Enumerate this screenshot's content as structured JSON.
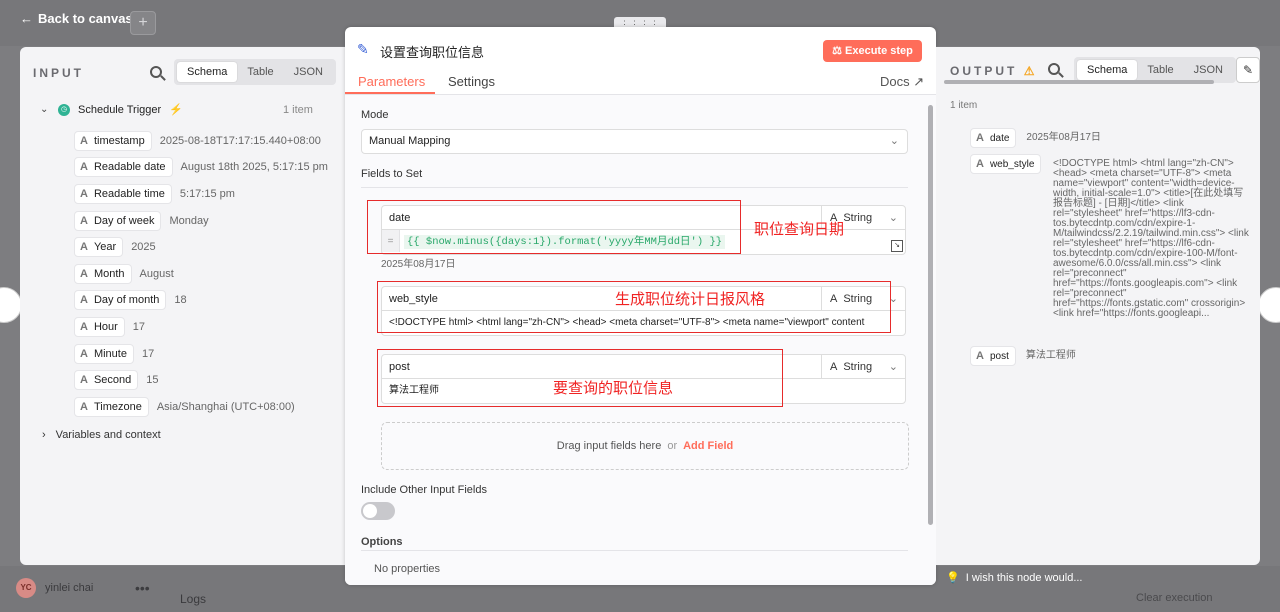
{
  "topbar": {
    "back_label": "Back to canvas",
    "plus": "+",
    "handle": "⋮⋮⋮⋮"
  },
  "input": {
    "title": "INPUT",
    "tabs": [
      "Schema",
      "Table",
      "JSON"
    ],
    "node": {
      "name": "Schedule Trigger",
      "count": "1 item"
    },
    "fields": [
      {
        "key": "timestamp",
        "value": "2025-08-18T17:17:15.440+08:00"
      },
      {
        "key": "Readable date",
        "value": "August 18th 2025, 5:17:15 pm"
      },
      {
        "key": "Readable time",
        "value": "5:17:15 pm"
      },
      {
        "key": "Day of week",
        "value": "Monday"
      },
      {
        "key": "Year",
        "value": "2025"
      },
      {
        "key": "Month",
        "value": "August"
      },
      {
        "key": "Day of month",
        "value": "18"
      },
      {
        "key": "Hour",
        "value": "17"
      },
      {
        "key": "Minute",
        "value": "17"
      },
      {
        "key": "Second",
        "value": "15"
      },
      {
        "key": "Timezone",
        "value": "Asia/Shanghai (UTC+08:00)"
      }
    ],
    "vars_label": "Variables and context"
  },
  "dialog": {
    "title": "设置查询职位信息",
    "execute": "Execute step",
    "tabs": {
      "parameters": "Parameters",
      "settings": "Settings",
      "docs": "Docs"
    },
    "mode_label": "Mode",
    "mode_value": "Manual Mapping",
    "fields_label": "Fields to Set",
    "type_label": "String",
    "fields": [
      {
        "name": "date",
        "value": "{{ $now.minus({days:1}).format('yyyy年MM月dd日') }}",
        "eq": "=",
        "preview": "2025年08月17日"
      },
      {
        "name": "web_style",
        "value": "<!DOCTYPE html> <html lang=\"zh-CN\"> <head>     <meta charset=\"UTF-8\">     <meta name=\"viewport\" content"
      },
      {
        "name": "post",
        "value": "算法工程师"
      }
    ],
    "annotations": [
      "职位查询日期",
      "生成职位统计日报风格",
      "要查询的职位信息"
    ],
    "drop_text": "Drag input fields here",
    "drop_or": "or",
    "drop_add": "Add Field",
    "include_label": "Include Other Input Fields",
    "options_label": "Options",
    "no_props": "No properties"
  },
  "output": {
    "title": "OUTPUT",
    "tabs": [
      "Schema",
      "Table",
      "JSON"
    ],
    "count": "1 item",
    "date_key": "date",
    "date_value": "2025年08月17日",
    "web_key": "web_style",
    "web_value": "<!DOCTYPE html> <html lang=\"zh-CN\"> <head> <meta charset=\"UTF-8\"> <meta name=\"viewport\" content=\"width=device-width, initial-scale=1.0\"> <title>[在此处填写报告标题] - [日期]</title> <link rel=\"stylesheet\" href=\"https://lf3-cdn-tos.bytecdntp.com/cdn/expire-1-M/tailwindcss/2.2.19/tailwind.min.css\"> <link rel=\"stylesheet\" href=\"https://lf6-cdn-tos.bytecdntp.com/cdn/expire-100-M/font-awesome/6.0.0/css/all.min.css\"> <link rel=\"preconnect\" href=\"https://fonts.googleapis.com\"> <link rel=\"preconnect\" href=\"https://fonts.gstatic.com\" crossorigin> <link href=\"https://fonts.googleapi...",
    "post_key": "post",
    "post_value": "算法工程师"
  },
  "bottom": {
    "user": "yinlei chai",
    "initials": "YC",
    "logs": "Logs",
    "wish": "I wish this node would...",
    "clear": "Clear execution"
  }
}
